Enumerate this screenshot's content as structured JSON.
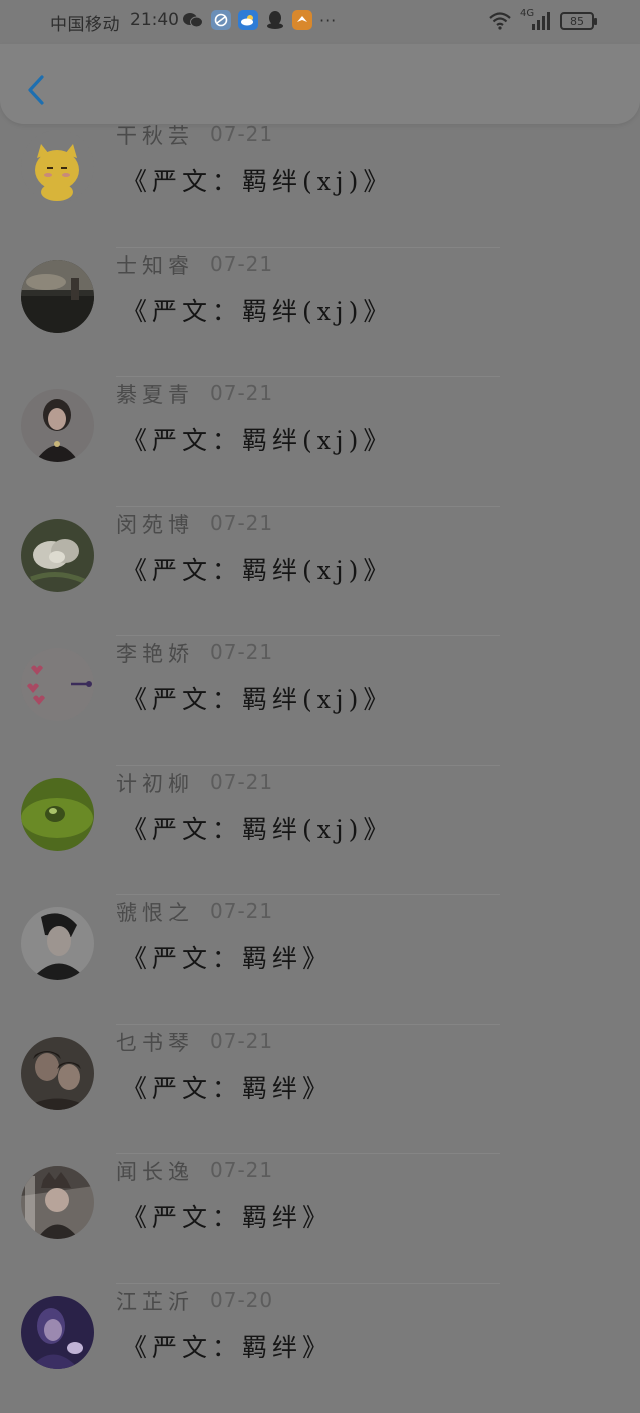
{
  "status_bar": {
    "carrier": "中国移动",
    "time": "21:40",
    "more": "···",
    "network": "4G",
    "battery": "85"
  },
  "items": [
    {
      "name": "干秋芸",
      "date": "07-21",
      "title": "《严文：羁绊(xj)》",
      "avatar": "cartoon-cat"
    },
    {
      "name": "士知睿",
      "date": "07-21",
      "title": "《严文：羁绊(xj)》",
      "avatar": "dusk-sky"
    },
    {
      "name": "綦夏青",
      "date": "07-21",
      "title": "《严文：羁绊(xj)》",
      "avatar": "girl-photo"
    },
    {
      "name": "闵苑博",
      "date": "07-21",
      "title": "《严文：羁绊(xj)》",
      "avatar": "white-flower"
    },
    {
      "name": "李艳娇",
      "date": "07-21",
      "title": "《严文：羁绊(xj)》",
      "avatar": "pink-hearts"
    },
    {
      "name": "计初柳",
      "date": "07-21",
      "title": "《严文：羁绊(xj)》",
      "avatar": "green-droplet"
    },
    {
      "name": "虢恨之",
      "date": "07-21",
      "title": "《严文：羁绊》",
      "avatar": "boy-portrait"
    },
    {
      "name": "乜书琴",
      "date": "07-21",
      "title": "《严文：羁绊》",
      "avatar": "two-boys"
    },
    {
      "name": "闻长逸",
      "date": "07-21",
      "title": "《严文：羁绊》",
      "avatar": "anime-character"
    },
    {
      "name": "江芷沂",
      "date": "07-20",
      "title": "《严文：羁绊》",
      "avatar": "purple-girl"
    }
  ]
}
